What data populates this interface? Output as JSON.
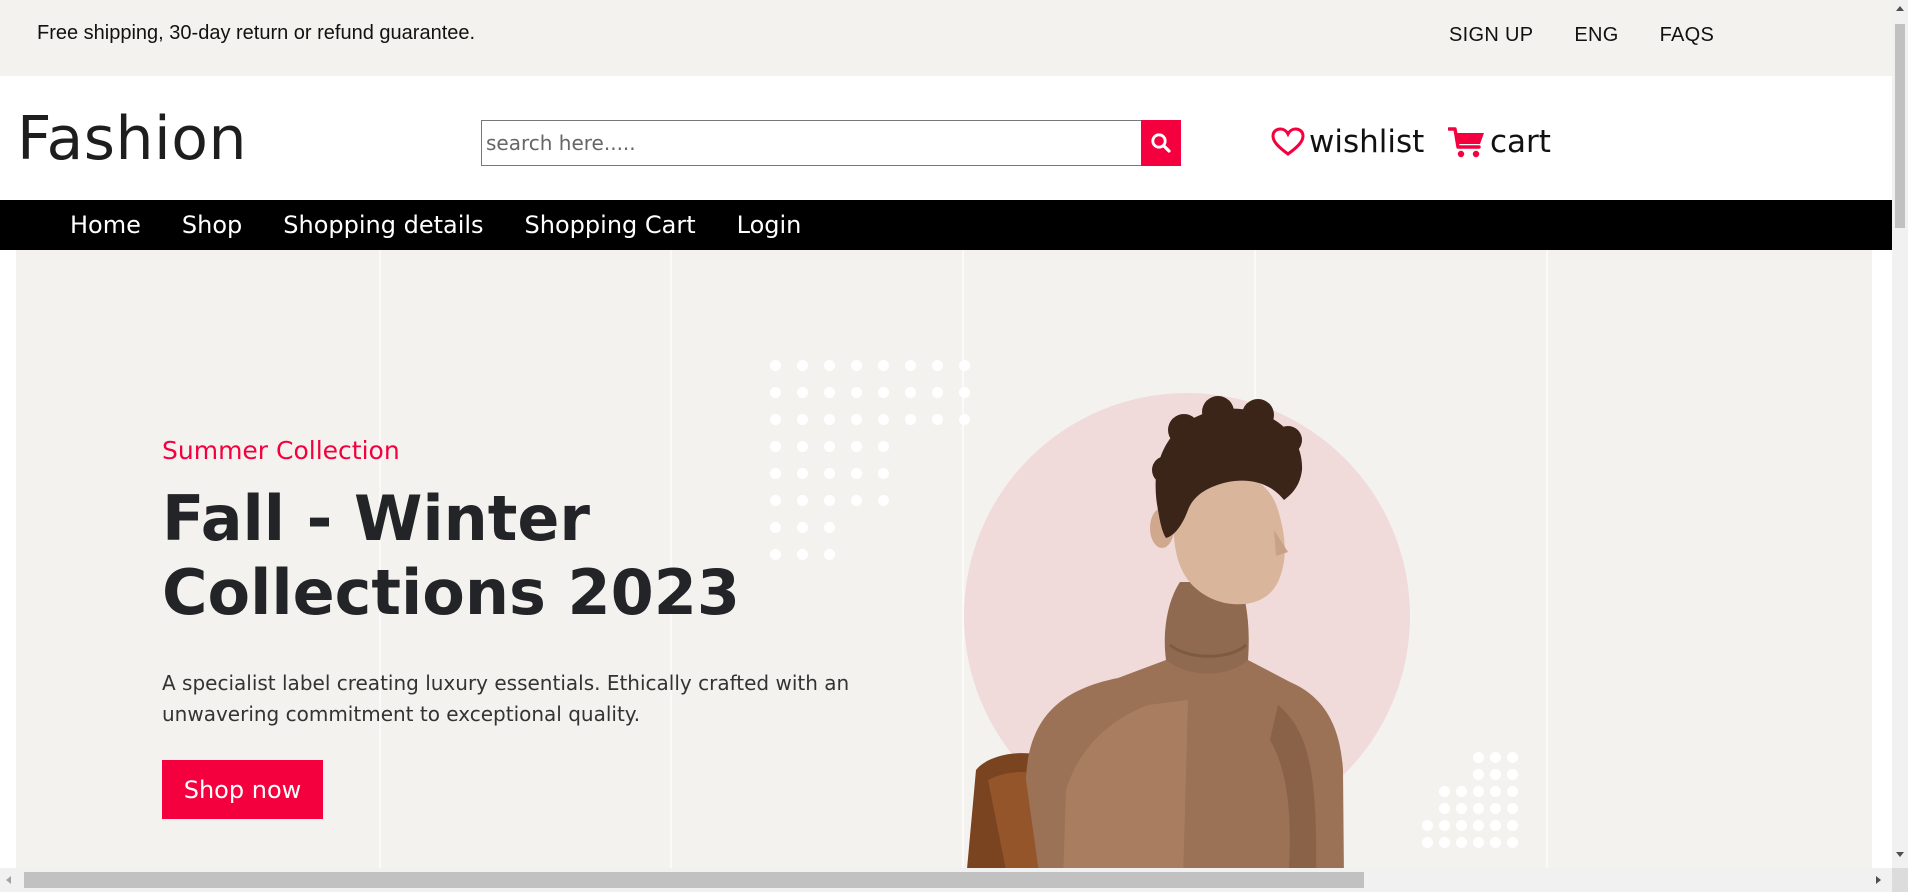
{
  "topbar": {
    "promo": "Free shipping, 30-day return or refund guarantee.",
    "links": [
      "SIGN UP",
      "ENG",
      "FAQS"
    ]
  },
  "header": {
    "logo": "Fashion",
    "search_placeholder": "search here.....",
    "search_icon": "search-icon",
    "wishlist_label": "wishlist",
    "wishlist_icon": "heart-outline-icon",
    "cart_label": "cart",
    "cart_icon": "shopping-cart-icon"
  },
  "nav": {
    "items": [
      "Home",
      "Shop",
      "Shopping details",
      "Shopping Cart",
      "Login"
    ]
  },
  "hero": {
    "subtitle": "Summer Collection",
    "title": "Fall - Winter Collections 2023",
    "description": "A specialist label creating luxury essentials. Ethically crafted with an unwavering commitment to exceptional quality.",
    "cta": "Shop now"
  },
  "colors": {
    "accent": "#f5003e",
    "topbar_bg": "#f3f2ee",
    "hero_bg": "#f3f2ee",
    "nav_bg": "#000000",
    "circle": "#f1dada"
  }
}
